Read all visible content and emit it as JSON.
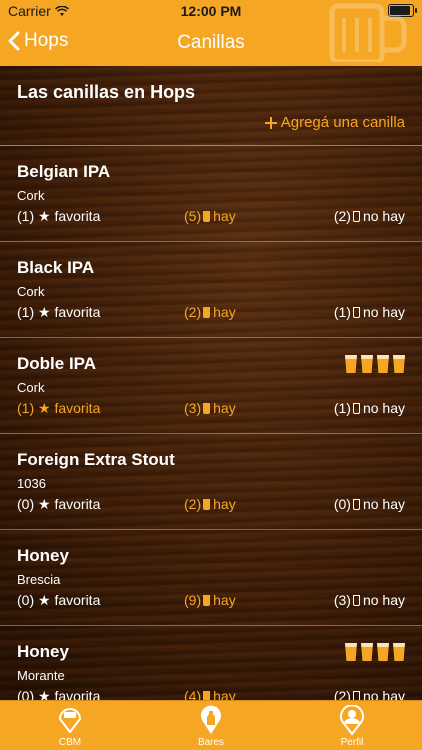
{
  "status": {
    "carrier": "Carrier",
    "time": "12:00 PM"
  },
  "nav": {
    "back_label": "Hops",
    "title": "Canillas"
  },
  "header": {
    "title": "Las canillas en Hops",
    "add_label": "Agregá una canilla"
  },
  "taps": [
    {
      "name": "Belgian IPA",
      "brewery": "Cork",
      "favorita": "(1) ★ favorita",
      "fav_active": false,
      "hay_count": "(5)",
      "hay_label": "hay",
      "nohay_count": "(2)",
      "nohay_label": "no hay",
      "rated": false
    },
    {
      "name": "Black IPA",
      "brewery": "Cork",
      "favorita": "(1) ★ favorita",
      "fav_active": false,
      "hay_count": "(2)",
      "hay_label": "hay",
      "nohay_count": "(1)",
      "nohay_label": "no hay",
      "rated": false
    },
    {
      "name": "Doble IPA",
      "brewery": "Cork",
      "favorita": "(1) ★ favorita",
      "fav_active": true,
      "hay_count": "(3)",
      "hay_label": "hay",
      "nohay_count": "(1)",
      "nohay_label": "no hay",
      "rated": true,
      "rating": 4
    },
    {
      "name": "Foreign Extra Stout",
      "brewery": "1036",
      "favorita": "(0) ★ favorita",
      "fav_active": false,
      "hay_count": "(2)",
      "hay_label": "hay",
      "nohay_count": "(0)",
      "nohay_label": "no hay",
      "rated": false
    },
    {
      "name": "Honey",
      "brewery": "Brescia",
      "favorita": "(0) ★ favorita",
      "fav_active": false,
      "hay_count": "(9)",
      "hay_label": "hay",
      "nohay_count": "(3)",
      "nohay_label": "no hay",
      "rated": false
    },
    {
      "name": "Honey",
      "brewery": "Morante",
      "favorita": "(0) ★ favorita",
      "fav_active": false,
      "hay_count": "(4)",
      "hay_label": "hay",
      "nohay_count": "(2)",
      "nohay_label": "no hay",
      "rated": true,
      "rating": 4
    }
  ],
  "tabbar": {
    "tabs": [
      {
        "label": "CBM"
      },
      {
        "label": "Bares"
      },
      {
        "label": "Perfil"
      }
    ]
  },
  "colors": {
    "accent": "#f5a623",
    "wood_dark": "#3b1c08"
  }
}
